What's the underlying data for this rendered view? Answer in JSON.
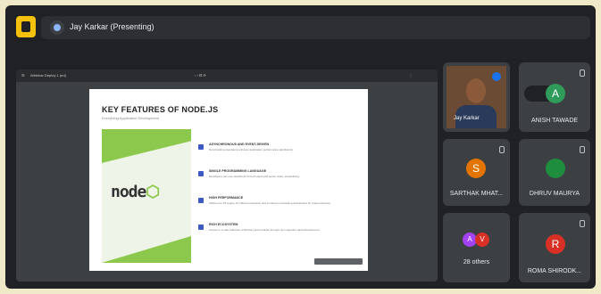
{
  "header": {
    "presenting_text": "Jay Karkar (Presenting)"
  },
  "presentation": {
    "toolbar_title": "Webinar Deploy 1 (ed)",
    "slide": {
      "title": "KEY FEATURES OF NODE.JS",
      "subtitle": "Everything Application Development",
      "logo_text": "node",
      "features": [
        {
          "heading": "ASYNCHRONOUS AND EVENT-DRIVEN",
          "description": "Non-blocking operations enhance application performance significantly."
        },
        {
          "heading": "SINGLE PROGRAMMING LANGUAGE",
          "description": "Developers can use JavaScript for both client and server sides, streamlining."
        },
        {
          "heading": "HIGH PERFORMANCE",
          "description": "Utilizes the V8 engine for efficient execution and a robust non-blocking architecture for responsiveness."
        },
        {
          "heading": "RICH ECOSYSTEM",
          "description": "Access to a vast collection of libraries and modules through npm supports rapid development."
        }
      ]
    }
  },
  "participants": [
    {
      "name": "Jay Karkar",
      "type": "video"
    },
    {
      "name": "ANISH TAWADE",
      "initial": "A",
      "color": "#2f9c5b"
    },
    {
      "name": "SARTHAK MHAT...",
      "initial": "S",
      "color": "#e37400"
    },
    {
      "name": "DHRUV MAURYA",
      "initial": "",
      "color": "#1e8e3e"
    },
    {
      "name": "28 others",
      "initial_1": "A",
      "initial_2": "V",
      "color_1": "#a142f4",
      "color_2": "#d93025"
    },
    {
      "name": "ROMA SHIRODK...",
      "initial": "R",
      "color": "#d93025"
    }
  ]
}
